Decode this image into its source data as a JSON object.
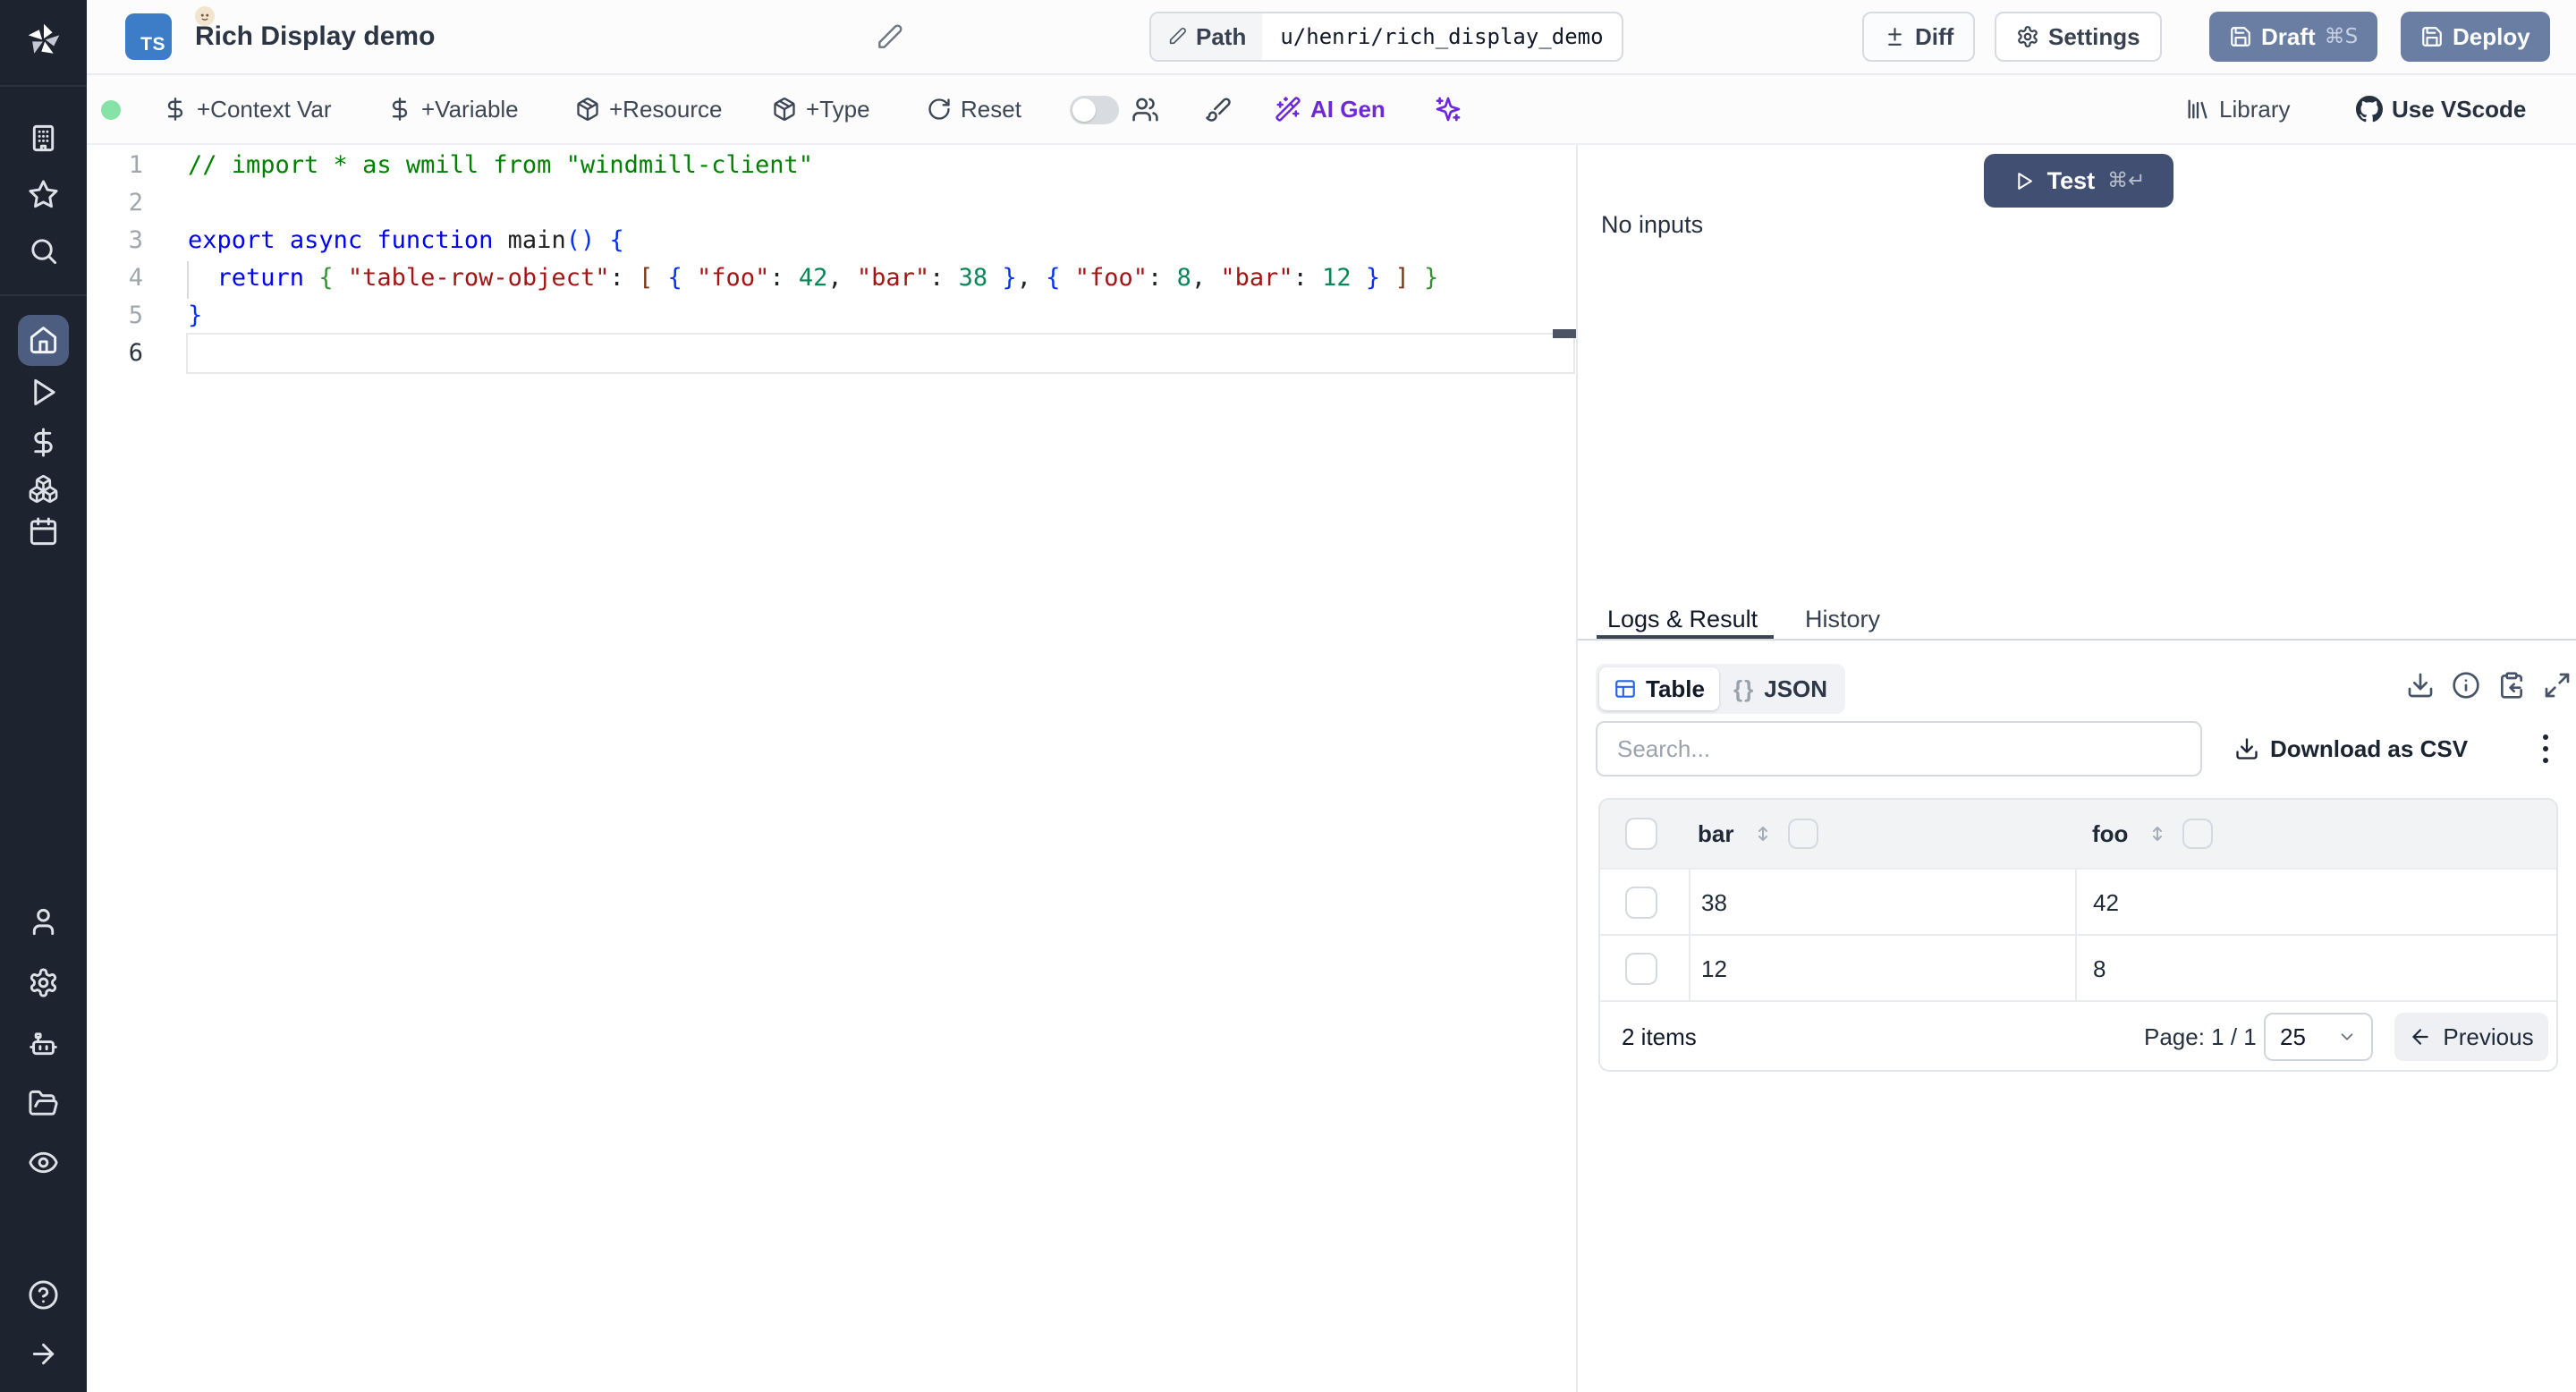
{
  "header": {
    "lang_badge": "TS",
    "title": "Rich Display demo",
    "path_label": "Path",
    "path_value": "u/henri/rich_display_demo",
    "diff_label": "Diff",
    "settings_label": "Settings",
    "draft_label": "Draft",
    "draft_shortcut": "⌘S",
    "deploy_label": "Deploy"
  },
  "toolbar": {
    "context_var": "+Context Var",
    "variable": "+Variable",
    "resource": "+Resource",
    "type": "+Type",
    "reset": "Reset",
    "ai_gen": "AI Gen",
    "library": "Library",
    "vscode": "Use VScode"
  },
  "editor": {
    "language": "typescript",
    "lines": [
      {
        "num": "1",
        "tokens": [
          [
            "cm",
            "// import * as wmill from \"windmill-client\""
          ]
        ]
      },
      {
        "num": "2",
        "tokens": []
      },
      {
        "num": "3",
        "tokens": [
          [
            "kw",
            "export"
          ],
          [
            "pln",
            " "
          ],
          [
            "kw",
            "async"
          ],
          [
            "pln",
            " "
          ],
          [
            "kw",
            "function"
          ],
          [
            "pln",
            " "
          ],
          [
            "fn",
            "main"
          ],
          [
            "b1",
            "()"
          ],
          [
            "pln",
            " "
          ],
          [
            "b1",
            "{"
          ]
        ]
      },
      {
        "num": "4",
        "tokens": [
          [
            "pln",
            "  "
          ],
          [
            "kw",
            "return"
          ],
          [
            "pln",
            " "
          ],
          [
            "b2",
            "{"
          ],
          [
            "pln",
            " "
          ],
          [
            "str",
            "\"table-row-object\""
          ],
          [
            "pln",
            ": "
          ],
          [
            "b3",
            "["
          ],
          [
            "pln",
            " "
          ],
          [
            "b1",
            "{"
          ],
          [
            "pln",
            " "
          ],
          [
            "str",
            "\"foo\""
          ],
          [
            "pln",
            ": "
          ],
          [
            "num",
            "42"
          ],
          [
            "pln",
            ", "
          ],
          [
            "str",
            "\"bar\""
          ],
          [
            "pln",
            ": "
          ],
          [
            "num",
            "38"
          ],
          [
            "pln",
            " "
          ],
          [
            "b1",
            "}"
          ],
          [
            "pln",
            ", "
          ],
          [
            "b1",
            "{"
          ],
          [
            "pln",
            " "
          ],
          [
            "str",
            "\"foo\""
          ],
          [
            "pln",
            ": "
          ],
          [
            "num",
            "8"
          ],
          [
            "pln",
            ", "
          ],
          [
            "str",
            "\"bar\""
          ],
          [
            "pln",
            ": "
          ],
          [
            "num",
            "12"
          ],
          [
            "pln",
            " "
          ],
          [
            "b1",
            "}"
          ],
          [
            "pln",
            " "
          ],
          [
            "b3",
            "]"
          ],
          [
            "pln",
            " "
          ],
          [
            "b2",
            "}"
          ]
        ]
      },
      {
        "num": "5",
        "tokens": [
          [
            "b1",
            "}"
          ]
        ]
      },
      {
        "num": "6",
        "tokens": [],
        "active": true
      }
    ]
  },
  "run_panel": {
    "test_label": "Test",
    "test_shortcut": "⌘↵",
    "no_inputs": "No inputs"
  },
  "result_panel": {
    "tabs": [
      {
        "label": "Logs & Result",
        "active": true
      },
      {
        "label": "History",
        "active": false
      }
    ],
    "view_toggle": {
      "table_label": "Table",
      "json_braces": "{}",
      "json_label": "JSON"
    },
    "search_placeholder": "Search...",
    "download_csv_label": "Download as CSV",
    "table": {
      "columns": [
        "bar",
        "foo"
      ],
      "rows": [
        [
          "38",
          "42"
        ],
        [
          "12",
          "8"
        ]
      ],
      "items_count": "2 items",
      "page_label": "Page: 1 / 1",
      "page_size": "25",
      "previous_label": "Previous"
    }
  },
  "colors": {
    "sidebar_bg": "#1e242f",
    "primary_button": "#6a7ea4",
    "test_button": "#404f72",
    "ai_accent": "#6d28d9",
    "status_dot": "#86e3a6",
    "table_icon": "#2563eb",
    "ts_badge": "#3d7dc8",
    "active_nav": "#4c5d80"
  }
}
